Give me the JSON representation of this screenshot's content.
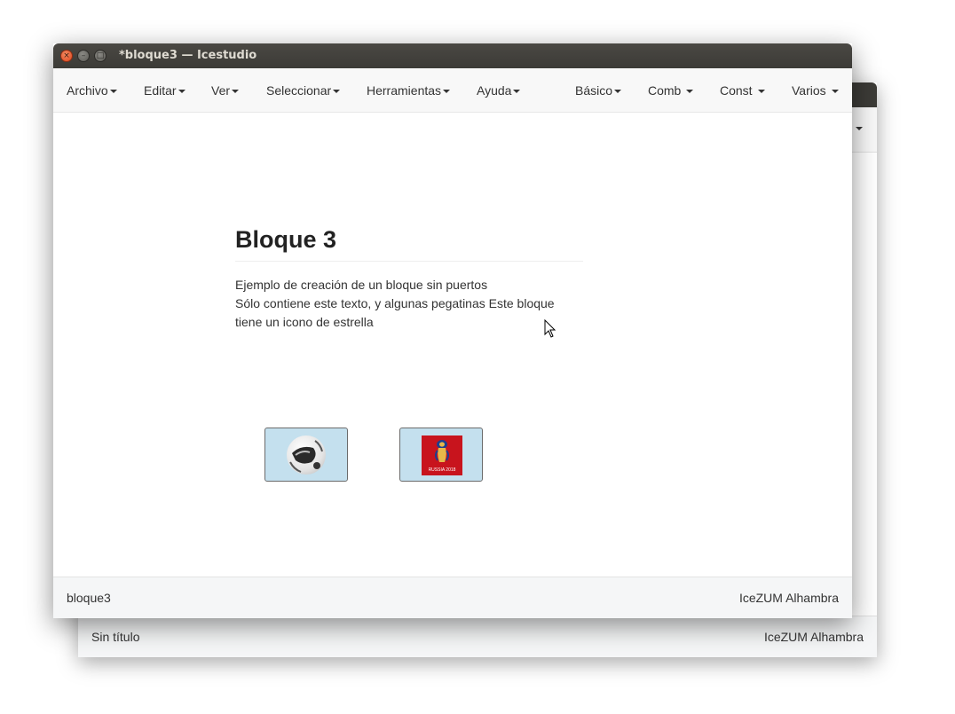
{
  "window": {
    "title": "*bloque3 — Icestudio",
    "close_glyph": "×",
    "minimize_glyph": "–",
    "maximize_glyph": "□"
  },
  "menu": {
    "left": [
      {
        "label": "Archivo"
      },
      {
        "label": "Editar"
      },
      {
        "label": "Ver"
      },
      {
        "label": "Seleccionar"
      },
      {
        "label": "Herramientas"
      },
      {
        "label": "Ayuda"
      }
    ],
    "right": [
      {
        "label": "Básico"
      },
      {
        "label": "Comb"
      },
      {
        "label": "Const"
      },
      {
        "label": "Varios"
      }
    ]
  },
  "info_block": {
    "title": "Bloque 3",
    "line1": "Ejemplo de creación de un bloque sin puertos",
    "line2": "Sólo contiene este texto, y algunas pegatinas Este bloque tiene un icono de estrella"
  },
  "stickers": [
    {
      "name": "ball-sticker",
      "icon": "soccer-ball-icon"
    },
    {
      "name": "emblem-sticker",
      "icon": "world-cup-emblem-icon",
      "emblem_text": "RUSSIA 2018"
    }
  ],
  "footer": {
    "project": "bloque3",
    "board": "IceZUM Alhambra"
  },
  "back_window": {
    "footer_project": "Sin título",
    "footer_board": "IceZUM Alhambra"
  },
  "colors": {
    "titlebar": "#3c3b37",
    "menubar": "#f8f8f8",
    "sticker_bg": "#c4e0ee",
    "close_button": "#e0461d",
    "emblem_red": "#c8141d"
  }
}
